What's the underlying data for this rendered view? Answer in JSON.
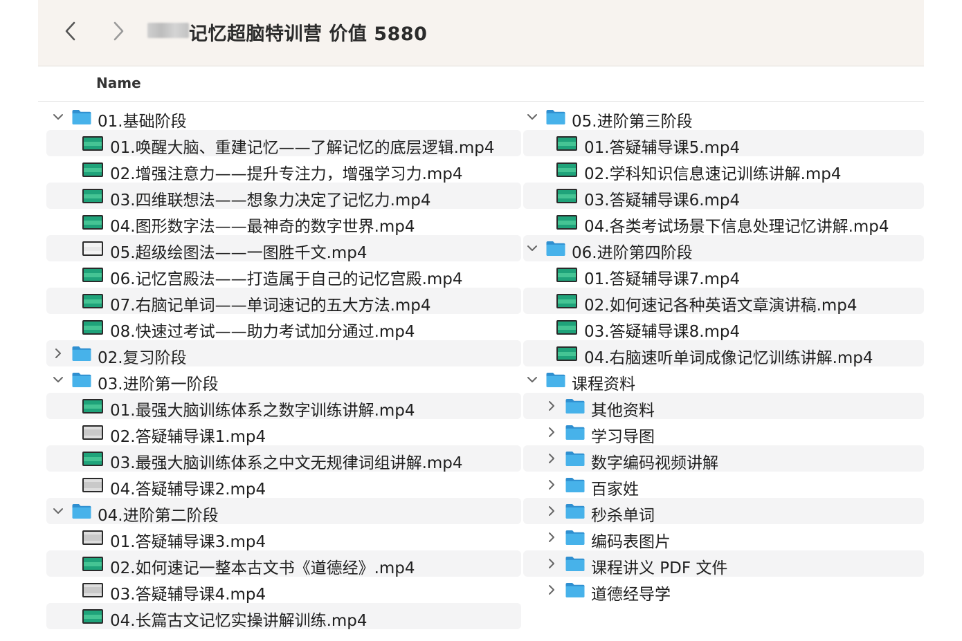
{
  "window": {
    "title": "记忆超脑特训营 价值 5880",
    "column_header": "Name"
  },
  "icons": {
    "back": "chevron-left-icon",
    "forward": "chevron-right-icon",
    "folder": "folder-icon",
    "video": "video-file-icon",
    "expanded": "chevron-down-icon",
    "collapsed": "chevron-right-icon"
  },
  "colors": {
    "folder": "#47b2ea",
    "video_green": "#1fa37a",
    "stripe": "#f4f4f5",
    "titlebar": "#f7f3ef"
  },
  "left_column": [
    {
      "kind": "folder",
      "expanded": true,
      "level": 0,
      "label": "01.基础阶段"
    },
    {
      "kind": "video",
      "level": 1,
      "thumb": "green",
      "label": "01.唤醒大脑、重建记忆——了解记忆的底层逻辑.mp4"
    },
    {
      "kind": "video",
      "level": 1,
      "thumb": "green",
      "label": "02.增强注意力——提升专注力，增强学习力.mp4"
    },
    {
      "kind": "video",
      "level": 1,
      "thumb": "green",
      "label": "03.四维联想法——想象力决定了记忆力.mp4"
    },
    {
      "kind": "video",
      "level": 1,
      "thumb": "green",
      "label": "04.图形数字法——最神奇的数字世界.mp4"
    },
    {
      "kind": "video",
      "level": 1,
      "thumb": "white",
      "label": "05.超级绘图法——一图胜千文.mp4"
    },
    {
      "kind": "video",
      "level": 1,
      "thumb": "green",
      "label": "06.记忆宫殿法——打造属于自己的记忆宫殿.mp4"
    },
    {
      "kind": "video",
      "level": 1,
      "thumb": "green",
      "label": "07.右脑记单词——单词速记的五大方法.mp4"
    },
    {
      "kind": "video",
      "level": 1,
      "thumb": "green",
      "label": "08.快速过考试——助力考试加分通过.mp4"
    },
    {
      "kind": "folder",
      "expanded": false,
      "level": 0,
      "label": "02.复习阶段"
    },
    {
      "kind": "folder",
      "expanded": true,
      "level": 0,
      "label": "03.进阶第一阶段"
    },
    {
      "kind": "video",
      "level": 1,
      "thumb": "green",
      "label": "01.最强大脑训练体系之数字训练讲解.mp4"
    },
    {
      "kind": "video",
      "level": 1,
      "thumb": "gray",
      "label": "02.答疑辅导课1.mp4"
    },
    {
      "kind": "video",
      "level": 1,
      "thumb": "green",
      "label": "03.最强大脑训练体系之中文无规律词组讲解.mp4"
    },
    {
      "kind": "video",
      "level": 1,
      "thumb": "gray",
      "label": "04.答疑辅导课2.mp4"
    },
    {
      "kind": "folder",
      "expanded": true,
      "level": 0,
      "label": "04.进阶第二阶段"
    },
    {
      "kind": "video",
      "level": 1,
      "thumb": "gray",
      "label": "01.答疑辅导课3.mp4"
    },
    {
      "kind": "video",
      "level": 1,
      "thumb": "green",
      "label": "02.如何速记一整本古文书《道德经》.mp4"
    },
    {
      "kind": "video",
      "level": 1,
      "thumb": "gray",
      "label": "03.答疑辅导课4.mp4"
    },
    {
      "kind": "video",
      "level": 1,
      "thumb": "green",
      "label": "04.长篇古文记忆实操讲解训练.mp4"
    }
  ],
  "right_column": [
    {
      "kind": "folder",
      "expanded": true,
      "level": 0,
      "label": "05.进阶第三阶段"
    },
    {
      "kind": "video",
      "level": 1,
      "thumb": "green",
      "label": "01.答疑辅导课5.mp4"
    },
    {
      "kind": "video",
      "level": 1,
      "thumb": "green",
      "label": "02.学科知识信息速记训练讲解.mp4"
    },
    {
      "kind": "video",
      "level": 1,
      "thumb": "green",
      "label": "03.答疑辅导课6.mp4"
    },
    {
      "kind": "video",
      "level": 1,
      "thumb": "green",
      "label": "04.各类考试场景下信息处理记忆讲解.mp4"
    },
    {
      "kind": "folder",
      "expanded": true,
      "level": 0,
      "label": "06.进阶第四阶段"
    },
    {
      "kind": "video",
      "level": 1,
      "thumb": "green",
      "label": "01.答疑辅导课7.mp4"
    },
    {
      "kind": "video",
      "level": 1,
      "thumb": "green",
      "label": "02.如何速记各种英语文章演讲稿.mp4"
    },
    {
      "kind": "video",
      "level": 1,
      "thumb": "green",
      "label": "03.答疑辅导课8.mp4"
    },
    {
      "kind": "video",
      "level": 1,
      "thumb": "green",
      "label": "04.右脑速听单词成像记忆训练讲解.mp4"
    },
    {
      "kind": "folder",
      "expanded": true,
      "level": 0,
      "label": "课程资料"
    },
    {
      "kind": "folder",
      "expanded": false,
      "level": 1,
      "label": "其他资料"
    },
    {
      "kind": "folder",
      "expanded": false,
      "level": 1,
      "label": "学习导图"
    },
    {
      "kind": "folder",
      "expanded": false,
      "level": 1,
      "label": "数字编码视频讲解"
    },
    {
      "kind": "folder",
      "expanded": false,
      "level": 1,
      "label": "百家姓"
    },
    {
      "kind": "folder",
      "expanded": false,
      "level": 1,
      "label": "秒杀单词"
    },
    {
      "kind": "folder",
      "expanded": false,
      "level": 1,
      "label": "编码表图片"
    },
    {
      "kind": "folder",
      "expanded": false,
      "level": 1,
      "label": "课程讲义 PDF 文件"
    },
    {
      "kind": "folder",
      "expanded": false,
      "level": 1,
      "label": "道德经导学"
    }
  ]
}
